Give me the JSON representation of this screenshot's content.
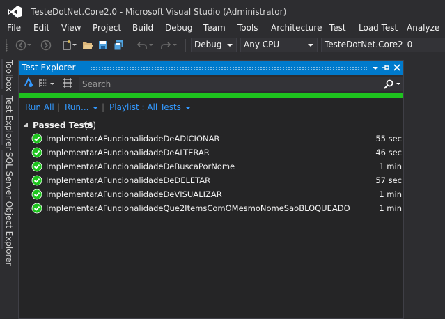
{
  "window": {
    "title": "TesteDotNet.Core2.0 - Microsoft Visual Studio  (Administrator)"
  },
  "menu": {
    "items": [
      "File",
      "Edit",
      "View",
      "Project",
      "Build",
      "Debug",
      "Team",
      "Tools",
      "Architecture",
      "Test",
      "Load Test",
      "Analyze"
    ]
  },
  "toolbar": {
    "configuration": "Debug",
    "platform": "Any CPU",
    "startup_project": "TesteDotNet.Core2_0"
  },
  "side_tabs": {
    "toolbox": "Toolbox",
    "test_explorer": "Test Explorer",
    "sql_explorer": "SQL Server Object Explorer"
  },
  "panel": {
    "title": "Test Explorer",
    "search_placeholder": "Search",
    "run_all": "Run All",
    "run": "Run...",
    "playlist": "Playlist : All Tests",
    "group": {
      "label": "Passed Tests",
      "count": "(6)"
    },
    "tests": [
      {
        "name": "ImplementarAFuncionalidadeDeADICIONAR",
        "duration": "55 sec"
      },
      {
        "name": "ImplementarAFuncionalidadeDeALTERAR",
        "duration": "46 sec"
      },
      {
        "name": "ImplementarAFuncionalidadeDeBuscaPorNome",
        "duration": "1 min"
      },
      {
        "name": "ImplementarAFuncionalidadeDeDELETAR",
        "duration": "57 sec"
      },
      {
        "name": "ImplementarAFuncionalidadeDeVISUALIZAR",
        "duration": "1 min"
      },
      {
        "name": "ImplementarAFuncionalidadeQue2ItemsComOMesmoNomeSaoBLOQUEADO",
        "duration": "1 min"
      }
    ],
    "status": "passed"
  },
  "colors": {
    "accent": "#007acc",
    "link": "#3399ff",
    "pass": "#1ec31e"
  },
  "icons": {
    "logo": "visual-studio-logo-icon",
    "pass": "check-circle-icon"
  }
}
